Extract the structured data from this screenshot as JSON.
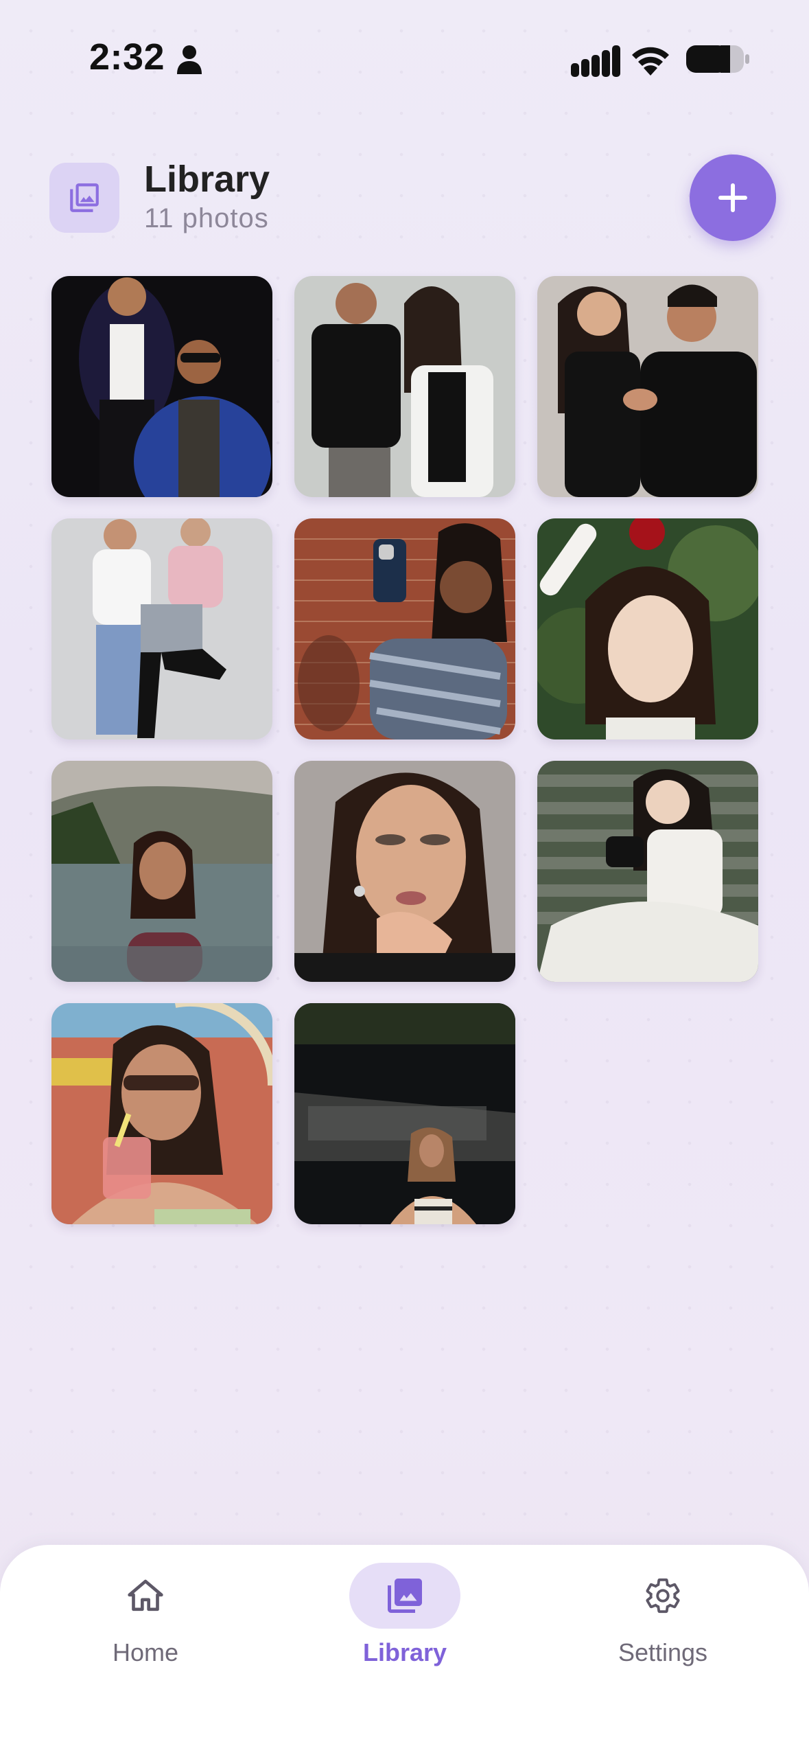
{
  "status_bar": {
    "time": "2:32"
  },
  "header": {
    "title": "Library",
    "subtitle": "11 photos"
  },
  "colors": {
    "accent": "#8c6ee0",
    "accent_light": "#dcd3f4",
    "active_nav": "#7f62d9"
  },
  "photos": [
    {
      "description": "couple in dark jackets on black backdrop"
    },
    {
      "description": "man and woman in black and white on grey backdrop"
    },
    {
      "description": "smiling couple in black shirts"
    },
    {
      "description": "couple posing playfully on white backdrop"
    },
    {
      "description": "woman taking selfie at brick wall"
    },
    {
      "description": "woman with apple on head outdoors"
    },
    {
      "description": "woman in infinity pool with mountains"
    },
    {
      "description": "woman with glitter eye makeup"
    },
    {
      "description": "woman in white dress holding camera on steps"
    },
    {
      "description": "woman in sunglasses drinking at fair"
    },
    {
      "description": "woman standing in dark street at dusk"
    }
  ],
  "bottom_nav": {
    "items": [
      {
        "label": "Home",
        "icon": "home-icon",
        "active": false
      },
      {
        "label": "Library",
        "icon": "photo-library-icon",
        "active": true
      },
      {
        "label": "Settings",
        "icon": "gear-icon",
        "active": false
      }
    ]
  }
}
